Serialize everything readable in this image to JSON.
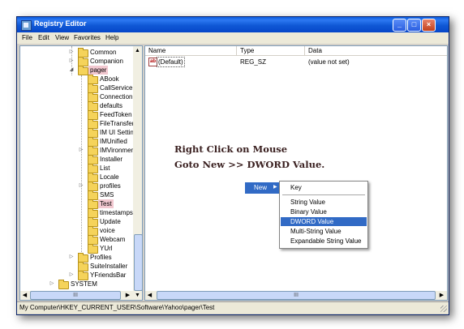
{
  "window": {
    "title": "Registry Editor",
    "minimize": "_",
    "maximize": "□",
    "close": "×"
  },
  "menu": {
    "items": [
      "File",
      "Edit",
      "View",
      "Favorites",
      "Help"
    ]
  },
  "tree": {
    "items": [
      {
        "label": "Common",
        "state": "collapsed"
      },
      {
        "label": "Companion",
        "state": "collapsed"
      },
      {
        "label": "pager",
        "state": "expanded",
        "selected": true
      },
      {
        "label": "ABook"
      },
      {
        "label": "CallService"
      },
      {
        "label": "Connection"
      },
      {
        "label": "defaults"
      },
      {
        "label": "FeedToken"
      },
      {
        "label": "FileTransfer"
      },
      {
        "label": "IM UI Settin"
      },
      {
        "label": "IMUnified"
      },
      {
        "label": "IMVironment",
        "state": "collapsed"
      },
      {
        "label": "Installer"
      },
      {
        "label": "List"
      },
      {
        "label": "Locale"
      },
      {
        "label": "profiles",
        "state": "collapsed"
      },
      {
        "label": "SMS"
      },
      {
        "label": "Test",
        "selected": true
      },
      {
        "label": "timestamps"
      },
      {
        "label": "Update"
      },
      {
        "label": "voice"
      },
      {
        "label": "Webcam"
      },
      {
        "label": "YUrl"
      },
      {
        "label": "Profiles",
        "state": "collapsed"
      },
      {
        "label": "SuiteInstaller"
      },
      {
        "label": "YFriendsBar",
        "state": "collapsed"
      },
      {
        "label": "SYSTEM",
        "state": "collapsed"
      }
    ]
  },
  "list": {
    "columns": [
      "Name",
      "Type",
      "Data"
    ],
    "rows": [
      {
        "name": "(Default)",
        "type": "REG_SZ",
        "data": "(value not set)"
      }
    ]
  },
  "annotation": {
    "line1": "Right Click on Mouse",
    "line2": "Goto New >> DWORD Value."
  },
  "context_menu": {
    "new_label": "New",
    "items": [
      "Key",
      "String Value",
      "Binary Value",
      "DWORD Value",
      "Multi-String Value",
      "Expandable String Value"
    ],
    "highlighted": "DWORD Value"
  },
  "scroll": {
    "thumb_label": "III"
  },
  "status": {
    "path": "My Computer\\HKEY_CURRENT_USER\\Software\\Yahoo\\pager\\Test"
  },
  "colors": {
    "title_bar": "#0a5be0",
    "selection": "#316ac5",
    "tree_selected": "#f2c8d0"
  }
}
